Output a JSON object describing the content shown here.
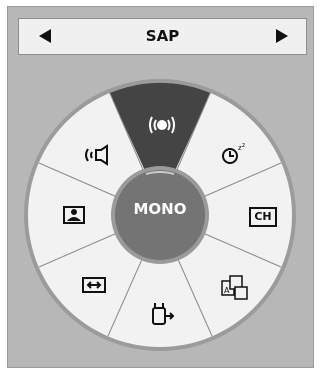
{
  "audio_selector": {
    "value": "SAP",
    "prev_icon": "left-arrow-icon",
    "next_icon": "right-arrow-icon"
  },
  "wheel": {
    "center_label": "MONO",
    "selected_item": "surround-icon",
    "items": [
      {
        "name": "surround",
        "icon": "surround-icon"
      },
      {
        "name": "sleep-timer",
        "icon": "sleep-timer-icon"
      },
      {
        "name": "channel",
        "icon": "ch-icon",
        "label": "CH"
      },
      {
        "name": "multi-language",
        "icon": "multi-language-icon"
      },
      {
        "name": "input",
        "icon": "input-icon"
      },
      {
        "name": "aspect-ratio",
        "icon": "aspect-ratio-icon"
      },
      {
        "name": "picture-mode",
        "icon": "picture-mode-icon"
      },
      {
        "name": "sound-mode",
        "icon": "sound-mode-icon"
      }
    ]
  },
  "colors": {
    "panel": "#b7b7b7",
    "ring": "#f2f2f2",
    "selected_segment": "#444444",
    "center": "#747474",
    "divider": "#8a8a8a"
  }
}
